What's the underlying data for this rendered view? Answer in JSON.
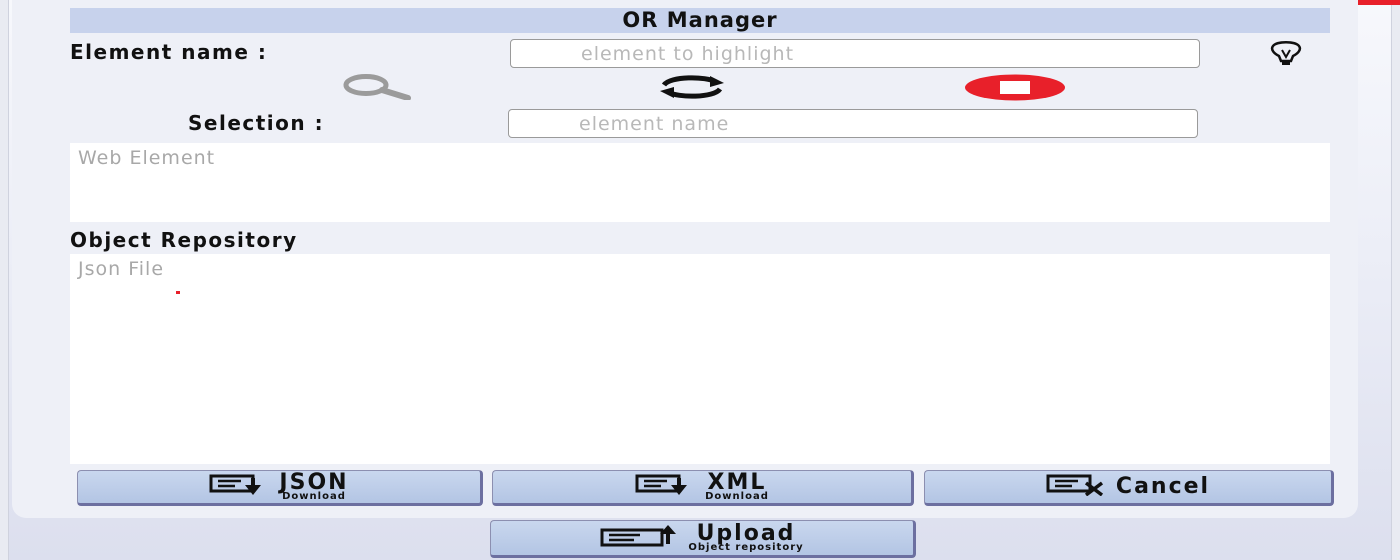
{
  "header": {
    "title": "OR Manager"
  },
  "element_name": {
    "label": "Element name :",
    "placeholder": "element to highlight",
    "value": ""
  },
  "toolbar": {
    "search_icon": "search-icon",
    "refresh_icon": "refresh-icon",
    "stop_icon": "stop-icon",
    "lightbulb_icon": "lightbulb-icon"
  },
  "selection": {
    "label": "Selection :",
    "placeholder": "element name",
    "value": ""
  },
  "web_element": {
    "placeholder": "Web Element"
  },
  "object_repository": {
    "label": "Object Repository",
    "placeholder": "Json File"
  },
  "buttons": {
    "json": {
      "label": "JSON",
      "sub": "Download",
      "icon": "download-icon"
    },
    "xml": {
      "label": "XML",
      "sub": "Download",
      "icon": "download-icon"
    },
    "cancel": {
      "label": "Cancel",
      "icon": "clear-icon"
    },
    "upload": {
      "label": "Upload",
      "sub": "Object repository",
      "icon": "upload-icon"
    }
  },
  "colors": {
    "title_bar": "#c7d2ec",
    "button": "#b3c5e4",
    "stop": "#e8202a"
  }
}
